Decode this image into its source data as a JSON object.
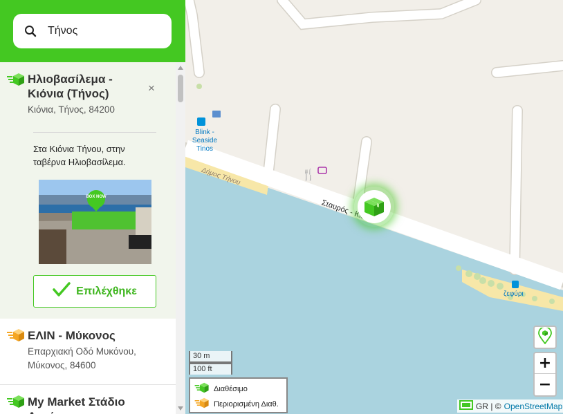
{
  "search": {
    "value": "Τήνος"
  },
  "locations": [
    {
      "title": "Ηλιοβασίλεμα - Κιόνια (Τήνος)",
      "address": "Κιόνια, Τήνος, 84200",
      "description": "Στα Κιόνια Τήνου, στην ταβέρνα Ηλιοβασίλεμα.",
      "photo_label": "BOX NOW",
      "selected_button": "Επιλέχθηκε",
      "close_icon": "×",
      "status": "available"
    },
    {
      "title": "ΕΛΙΝ - Μύκονος",
      "address": "Επαρχιακή Οδό Μυκόνου, Μύκονος, 84600",
      "status": "limited"
    },
    {
      "title": "My Market Στάδιο Αγκάιος",
      "status": "available"
    }
  ],
  "map": {
    "labels": {
      "hotel": "Blink - Seaside Tinos",
      "municipality": "Δήμος Τήνου",
      "road": "Σταυρός - Κιόνια",
      "bus_stop": "ζεφύρι"
    },
    "scale": {
      "metric": "30 m",
      "imperial": "100 ft"
    },
    "zoom": {
      "in": "+",
      "out": "−"
    },
    "legend": [
      {
        "label": "Διαθέσιμο",
        "color": "#44c822"
      },
      {
        "label": "Περιορισμένη Διαθ.",
        "color": "#f5a623"
      }
    ],
    "attribution": {
      "prefix": "GR | ©",
      "link": "OpenStreetMap"
    }
  },
  "colors": {
    "brand_green": "#44c822",
    "limited_orange": "#f5a623",
    "sea": "#aad3df",
    "land": "#f2efe9"
  }
}
